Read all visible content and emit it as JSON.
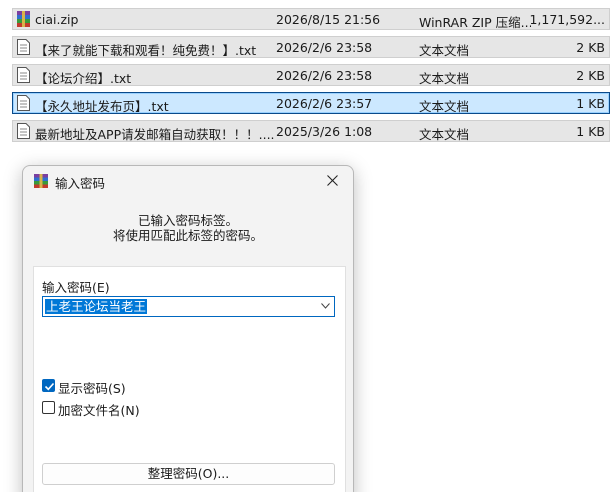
{
  "files": [
    {
      "name": "ciai.zip",
      "date": "2026/8/15 21:56",
      "type": "WinRAR ZIP 压缩...",
      "size": "1,171,592...",
      "icon": "winrar-archive-icon",
      "selected": false
    },
    {
      "name": "【来了就能下载和观看！纯免费！】.txt",
      "date": "2026/2/6 23:58",
      "type": "文本文档",
      "size": "2 KB",
      "icon": "text-file-icon",
      "selected": false
    },
    {
      "name": "【论坛介绍】.txt",
      "date": "2026/2/6 23:58",
      "type": "文本文档",
      "size": "2 KB",
      "icon": "text-file-icon",
      "selected": false
    },
    {
      "name": "【永久地址发布页】.txt",
      "date": "2026/2/6 23:57",
      "type": "文本文档",
      "size": "1 KB",
      "icon": "text-file-icon",
      "selected": true
    },
    {
      "name": "最新地址及APP请发邮箱自动获取！！！....",
      "date": "2025/3/26 1:08",
      "type": "文本文档",
      "size": "1 KB",
      "icon": "text-file-icon",
      "selected": false
    }
  ],
  "dialog": {
    "title": "输入密码",
    "info_line1": "已输入密码标签。",
    "info_line2": "将使用匹配此标签的密码。",
    "password_label": "输入密码(E)",
    "password_value": "上老王论坛当老王",
    "show_password_label": "显示密码(S)",
    "show_password_checked": true,
    "encrypt_names_label": "加密文件名(N)",
    "encrypt_names_checked": false,
    "organize_button": "整理密码(O)..."
  },
  "colors": {
    "selection": "#cce8ff",
    "accent": "#0067c0",
    "row_bg": "#e6e6e6"
  }
}
